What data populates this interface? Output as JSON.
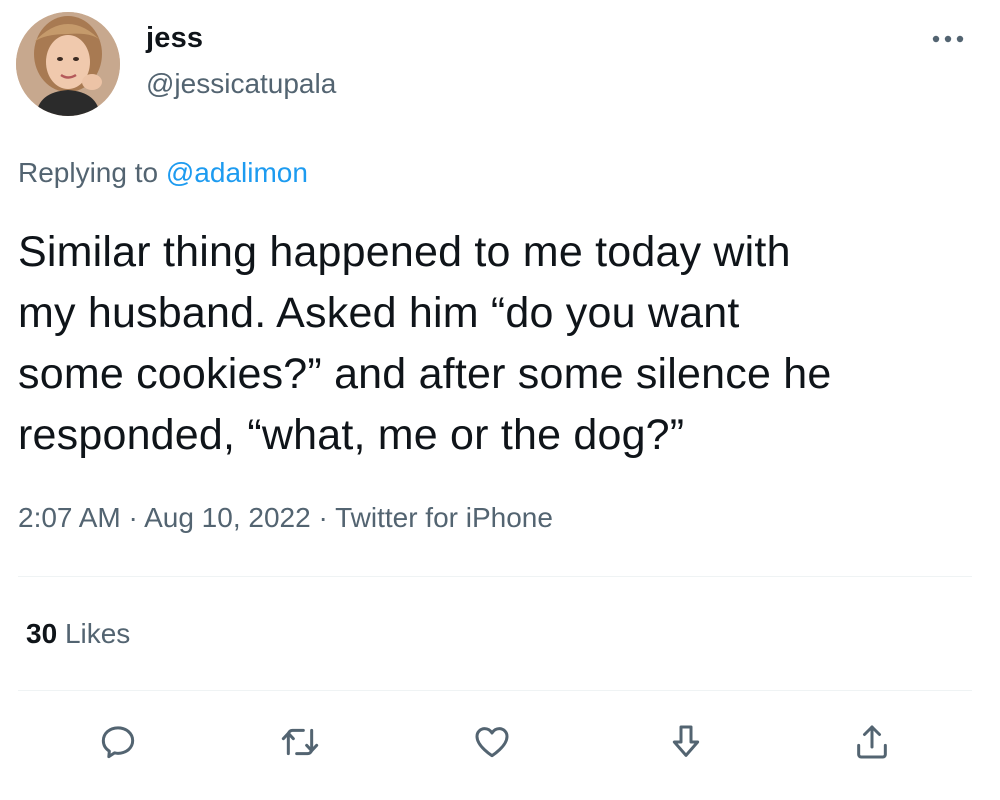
{
  "user": {
    "display_name": "jess",
    "handle": "@jessicatupala"
  },
  "reply": {
    "prefix": "Replying to",
    "mention": "@adalimon"
  },
  "tweet": {
    "text": "Similar thing happened to me today with\nmy husband. Asked him “do you want\nsome cookies?” and after some silence he\nresponded, “what, me or the dog?”"
  },
  "meta": {
    "time": "2:07 AM",
    "separator": "·",
    "date": "Aug 10, 2022",
    "source": "Twitter for iPhone"
  },
  "stats": {
    "likes_count": "30",
    "likes_label": "Likes"
  },
  "actions": [
    "reply-icon",
    "retweet-icon",
    "like-icon",
    "bookmark-icon",
    "share-icon"
  ],
  "colors": {
    "text_primary": "#0f1419",
    "text_secondary": "#536471",
    "accent": "#1d9bf0",
    "divider": "#eff3f4"
  }
}
